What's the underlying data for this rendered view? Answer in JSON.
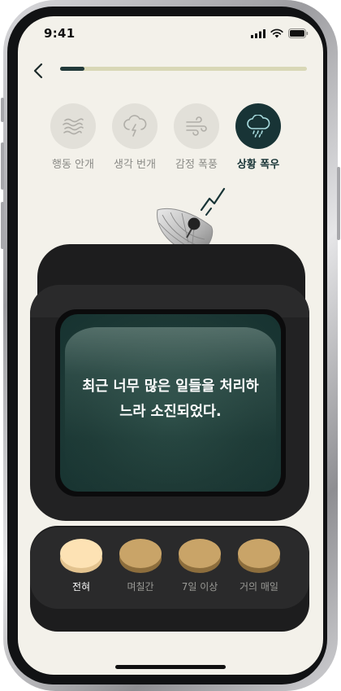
{
  "status_bar": {
    "time": "9:41"
  },
  "progress": {
    "fraction": 0.1
  },
  "categories": [
    {
      "label": "행동 안개",
      "icon": "fog-icon",
      "active": false
    },
    {
      "label": "생각 번개",
      "icon": "lightning-icon",
      "active": false
    },
    {
      "label": "감정 폭풍",
      "icon": "wind-icon",
      "active": false
    },
    {
      "label": "상황 폭우",
      "icon": "rain-icon",
      "active": true
    }
  ],
  "question": "최근 너무 많은 일들을 처리하느라 소진되었다.",
  "answers": [
    {
      "label": "전혀",
      "selected": true
    },
    {
      "label": "며칠간",
      "selected": false
    },
    {
      "label": "7일 이상",
      "selected": false
    },
    {
      "label": "거의 매일",
      "selected": false
    }
  ],
  "colors": {
    "background": "#f3f1ea",
    "accent": "#183436",
    "coin_selected": "#fde2b4",
    "coin": "#c9a468"
  }
}
